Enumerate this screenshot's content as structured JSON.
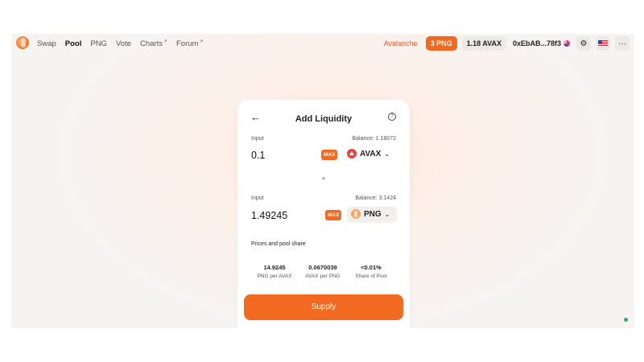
{
  "nav": {
    "items": [
      {
        "label": "Swap",
        "ext": ""
      },
      {
        "label": "Pool",
        "ext": ""
      },
      {
        "label": "PNG",
        "ext": ""
      },
      {
        "label": "Vote",
        "ext": ""
      },
      {
        "label": "Charts",
        "ext": "↗"
      },
      {
        "label": "Forum",
        "ext": "↗"
      }
    ],
    "active": "Pool"
  },
  "header": {
    "network": "Avalanche",
    "png_balance": "3 PNG",
    "avax_balance": "1.18 AVAX",
    "address": "0xEbAB...78f3",
    "more": "···"
  },
  "card": {
    "title": "Add Liquidity",
    "back": "←",
    "help": "?",
    "input_label": "Input",
    "input_a": {
      "amount": "0.1",
      "balance": "Balance: 1.18072",
      "max": "MAX",
      "symbol": "AVAX"
    },
    "input_b": {
      "amount": "1.49245",
      "balance": "Balance: 3.1424",
      "max": "MAX",
      "symbol": "PNG"
    },
    "plus": "+",
    "section_title": "Prices and pool share",
    "stats": [
      {
        "value": "14.9245",
        "label": "PNG per AVAX"
      },
      {
        "value": "0.0670039",
        "label": "AVAX per PNG"
      },
      {
        "value": "<0.01%",
        "label": "Share of Pool"
      }
    ],
    "supply": "Supply"
  },
  "colors": {
    "accent": "#f26a21",
    "network": "#e8542b"
  },
  "status_indicator": "green"
}
